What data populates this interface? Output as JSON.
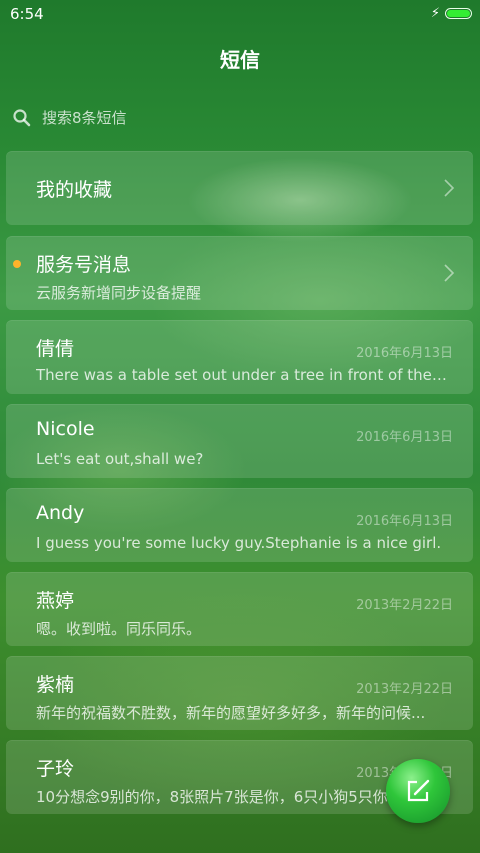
{
  "status_bar": {
    "time": "6:54",
    "battery_level": 1.0,
    "charging": true
  },
  "title": "短信",
  "search": {
    "placeholder": "搜索8条短信"
  },
  "favorites": {
    "label": "我的收藏"
  },
  "service": {
    "name": "服务号消息",
    "preview": "云服务新增同步设备提醒",
    "unread": true
  },
  "threads": [
    {
      "name": "倩倩",
      "preview": "There was a table set out under a tree in front of the ho...",
      "date": "2016年6月13日"
    },
    {
      "name": "Nicole",
      "preview": "Let's eat out,shall we?",
      "date": "2016年6月13日"
    },
    {
      "name": "Andy",
      "preview": "I guess you're some lucky guy.Stephanie is a nice girl.",
      "date": "2016年6月13日"
    },
    {
      "name": "燕婷",
      "preview": "嗯。收到啦。同乐同乐。",
      "date": "2013年2月22日"
    },
    {
      "name": "紫楠",
      "preview": "新年的祝福数不胜数，新年的愿望好多好多，新年的问候...",
      "date": "2013年2月22日"
    },
    {
      "name": "子玲",
      "preview": "10分想念9别的你，8张照片7张是你，6只小狗5只你...",
      "date": "2013年2月22日"
    }
  ],
  "colors": {
    "accent": "#33ee33",
    "unread_dot": "#ffb32b",
    "fab": "#2fc63a"
  }
}
